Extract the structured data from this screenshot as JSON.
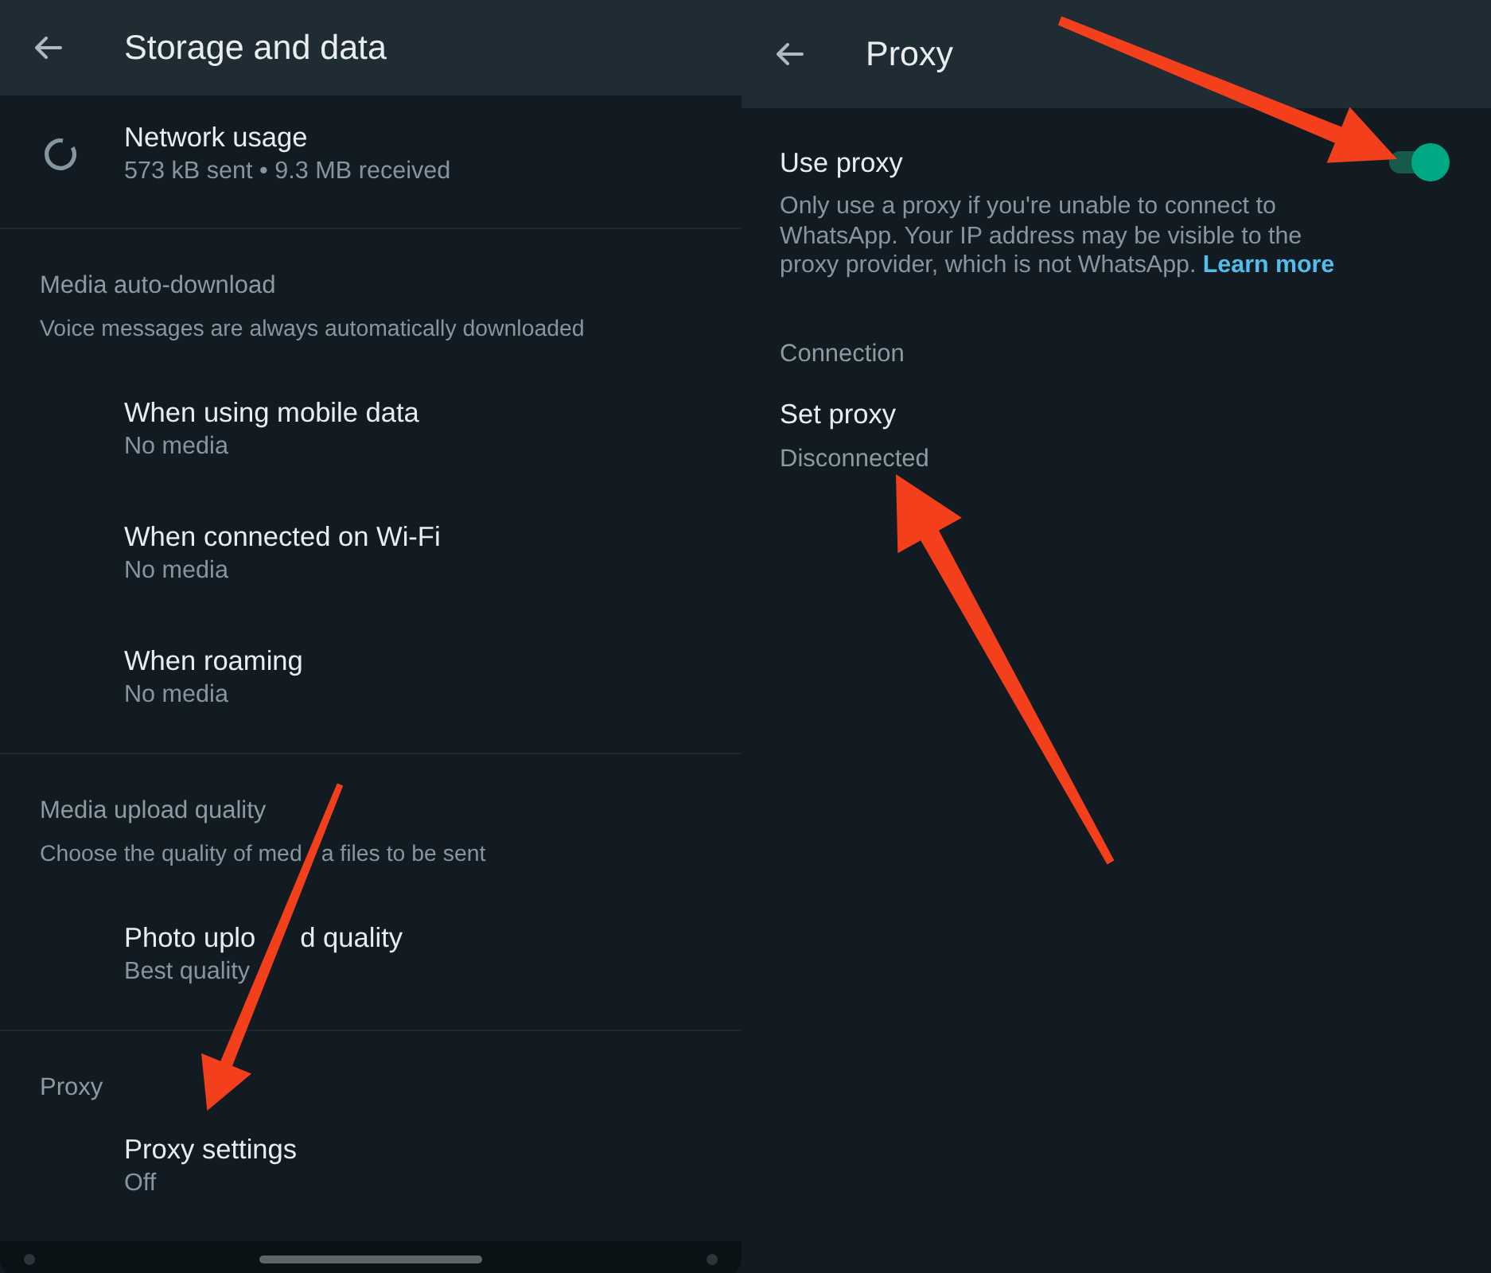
{
  "storage_screen": {
    "title": "Storage and data",
    "sections": [
      {
        "items": [
          {
            "kind": "usage",
            "title": "Network usage",
            "subtitle": "573 kB sent • 9.3 MB received"
          }
        ]
      },
      {
        "heading": "Media auto-download",
        "note": "Voice messages are always automatically downloaded",
        "items": [
          {
            "kind": "setting",
            "title": "When using mobile data",
            "subtitle": "No media"
          },
          {
            "kind": "setting",
            "title": "When connected on Wi-Fi",
            "subtitle": "No media"
          },
          {
            "kind": "setting",
            "title": "When roaming",
            "subtitle": "No media"
          }
        ]
      },
      {
        "heading": "Media upload quality",
        "note": [
          "Choose the quality of med",
          "a files to be sent"
        ],
        "items": [
          {
            "kind": "setting",
            "title": [
              "Photo uplo",
              "d quality"
            ],
            "subtitle": "Best quality"
          }
        ]
      },
      {
        "heading": "Proxy",
        "items": [
          {
            "kind": "setting",
            "title": "Proxy settings",
            "subtitle": "Off"
          }
        ]
      }
    ]
  },
  "proxy_screen": {
    "title": "Proxy",
    "use_proxy": {
      "label": "Use proxy",
      "on": true,
      "description": "Only use a proxy if you're unable to connect to WhatsApp. Your IP address may be visible to the proxy provider, which is not WhatsApp.",
      "link": "Learn more"
    },
    "connection": {
      "heading": "Connection",
      "title": "Set proxy",
      "status": "Disconnected"
    }
  },
  "annotations": [
    {
      "kind": "arrow"
    },
    {
      "kind": "arrow"
    },
    {
      "kind": "arrow"
    }
  ]
}
